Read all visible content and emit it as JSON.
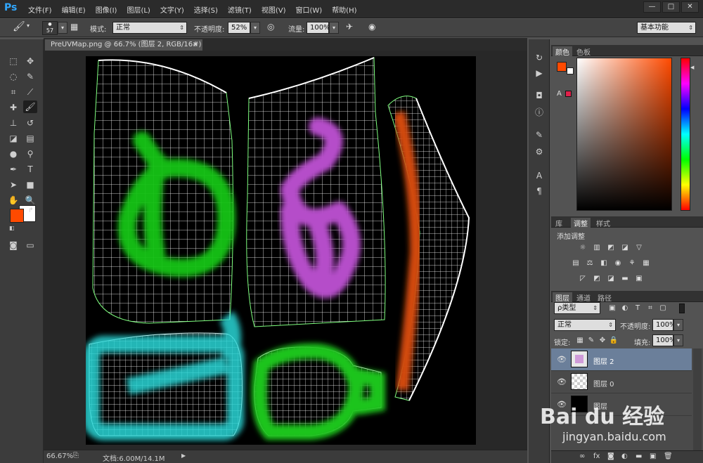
{
  "app": {
    "logo": "Ps"
  },
  "menu": [
    "文件(F)",
    "编辑(E)",
    "图像(I)",
    "图层(L)",
    "文字(Y)",
    "选择(S)",
    "滤镜(T)",
    "视图(V)",
    "窗口(W)",
    "帮助(H)"
  ],
  "window_controls": {
    "minimize": "—",
    "restore": "□",
    "close": "✕"
  },
  "options": {
    "brush_size": "57",
    "mode_label": "模式:",
    "mode_value": "正常",
    "opacity_label": "不透明度:",
    "opacity_value": "52%",
    "flow_label": "流量:",
    "flow_value": "100%",
    "workspace": "基本功能"
  },
  "document": {
    "tab_title": "PreUVMap.png @ 66.7% (图层 2, RGB/16#) *",
    "tab_close": "×",
    "zoom": "66.67%",
    "doc_info": "文档:6.00M/14.1M"
  },
  "colors": {
    "foreground": "#ff4a00",
    "background": "#ffffff",
    "ui_accent": "#31a8ff"
  },
  "color_panel": {
    "tab_color": "颜色",
    "tab_swatches": "色板"
  },
  "adjust_panel": {
    "tab_library": "库",
    "tab_adjust": "调整",
    "tab_styles": "样式",
    "add_label": "添加调整"
  },
  "layers_panel": {
    "tab_layers": "图层",
    "tab_channels": "通道",
    "tab_paths": "路径",
    "filter_kind": "ρ类型",
    "blend_mode": "正常",
    "opacity_label": "不透明度:",
    "opacity_value": "100%",
    "lock_label": "锁定:",
    "fill_label": "填充:",
    "fill_value": "100%",
    "layers": [
      {
        "name": "图层 2",
        "selected": true
      },
      {
        "name": "图层 0",
        "selected": false
      },
      {
        "name": "图层",
        "selected": false
      }
    ]
  },
  "watermark": {
    "brand": "Bai du 经验",
    "url": "jingyan.baidu.com"
  }
}
